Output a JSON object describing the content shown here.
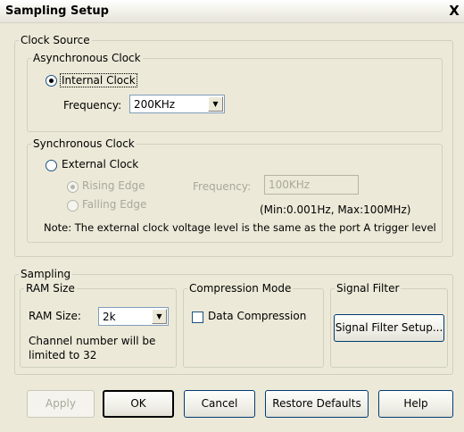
{
  "window": {
    "title": "Sampling Setup",
    "close_glyph": "X"
  },
  "clock_source": {
    "legend": "Clock Source",
    "async": {
      "legend": "Asynchronous Clock",
      "internal_clock_label": "Internal Clock",
      "internal_clock_selected": true,
      "frequency_label": "Frequency:",
      "frequency_value": "200KHz"
    },
    "sync": {
      "legend": "Synchronous Clock",
      "external_clock_label": "External Clock",
      "external_clock_selected": false,
      "rising_edge_label": "Rising Edge",
      "rising_edge_selected": true,
      "falling_edge_label": "Falling Edge",
      "falling_edge_selected": false,
      "frequency_label": "Frequency:",
      "frequency_value": "100KHz",
      "range_note": "(Min:0.001Hz, Max:100MHz)",
      "note": "Note: The external clock voltage level is the same as the port A trigger level"
    }
  },
  "sampling": {
    "legend": "Sampling",
    "ram": {
      "legend": "RAM Size",
      "label": "RAM Size:",
      "value": "2k",
      "note_line1": "Channel number will be",
      "note_line2": "limited to 32"
    },
    "compression": {
      "legend": "Compression Mode",
      "data_compression_label": "Data Compression",
      "data_compression_checked": false
    },
    "signal_filter": {
      "legend": "Signal Filter",
      "button_label": "Signal Filter Setup..."
    }
  },
  "buttons": {
    "apply": "Apply",
    "ok": "OK",
    "cancel": "Cancel",
    "restore_defaults": "Restore Defaults",
    "help": "Help"
  },
  "icons": {
    "dropdown_arrow": "chevron-down-icon",
    "close": "close-icon"
  }
}
